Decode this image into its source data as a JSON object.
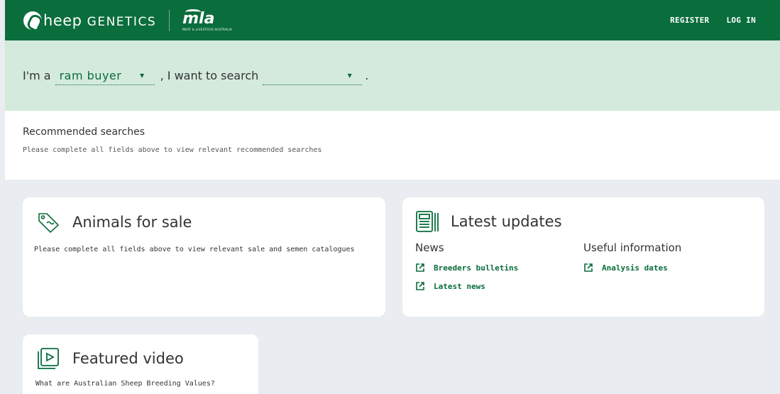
{
  "header": {
    "brand_letter_text": "heep",
    "brand_caps_text": "GENETICS",
    "partner_logo": "mla",
    "partner_sub": "MEAT & LIVESTOCK AUSTRALIA",
    "nav": {
      "register": "REGISTER",
      "login": "LOG IN"
    }
  },
  "search_bar": {
    "prefix": "I'm a",
    "role_value": "ram buyer",
    "middle": ", I want to search",
    "search_value": "",
    "suffix": "."
  },
  "recommended": {
    "title": "Recommended searches",
    "hint": "Please complete all fields above to view relevant recommended searches"
  },
  "animals_for_sale": {
    "title": "Animals for sale",
    "hint": "Please complete all fields above to view relevant sale and semen catalogues",
    "icon": "tag-icon"
  },
  "latest_updates": {
    "title": "Latest updates",
    "icon": "newspaper-icon",
    "news_heading": "News",
    "news_links": [
      "Breeders bulletins",
      "Latest news"
    ],
    "useful_heading": "Useful information",
    "useful_links": [
      "Analysis dates"
    ]
  },
  "featured_video": {
    "title": "Featured video",
    "icon": "video-icon",
    "caption": "What are Australian Sheep Breeding Values?"
  },
  "colors": {
    "brand_green": "#0a6d3c",
    "hero_bg": "#d4eadc",
    "page_bg": "#e9ecf0"
  }
}
